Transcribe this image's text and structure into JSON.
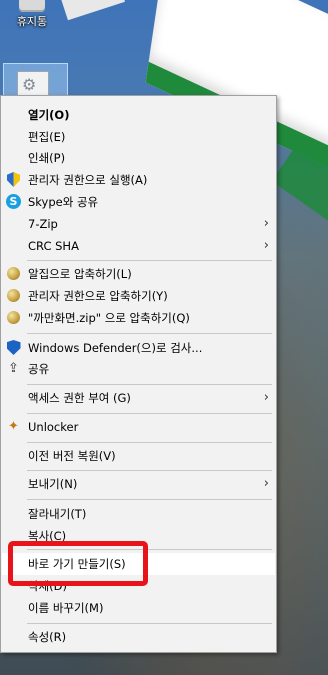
{
  "desktop": {
    "recycle_bin_label": "휴지통"
  },
  "context_menu": {
    "items": [
      {
        "label": "열기(O)",
        "icon": "",
        "bold": true
      },
      {
        "label": "편집(E)",
        "icon": ""
      },
      {
        "label": "인쇄(P)",
        "icon": ""
      },
      {
        "label": "관리자 권한으로 실행(A)",
        "icon": "uac-shield-icon"
      },
      {
        "label": "Skype와 공유",
        "icon": "skype-icon"
      },
      {
        "label": "7-Zip",
        "icon": "",
        "submenu": true
      },
      {
        "label": "CRC SHA",
        "icon": "",
        "submenu": true
      },
      {
        "label": "알집으로 압축하기(L)",
        "icon": "alzip-icon"
      },
      {
        "label": "관리자 권한으로 압축하기(Y)",
        "icon": "alzip-admin-icon"
      },
      {
        "label": "\"까만화면.zip\" 으로 압축하기(Q)",
        "icon": "alzip-icon"
      },
      {
        "label": "Windows Defender(으)로 검사...",
        "icon": "defender-icon"
      },
      {
        "label": "공유",
        "icon": "share-icon"
      },
      {
        "label": "액세스 권한 부여 (G)",
        "icon": "",
        "submenu": true
      },
      {
        "label": "Unlocker",
        "icon": "unlocker-wand-icon"
      },
      {
        "label": "이전 버전 복원(V)",
        "icon": ""
      },
      {
        "label": "보내기(N)",
        "icon": "",
        "submenu": true
      },
      {
        "label": "잘라내기(T)",
        "icon": ""
      },
      {
        "label": "복사(C)",
        "icon": ""
      },
      {
        "label": "바로 가기 만들기(S)",
        "icon": "",
        "highlighted": true
      },
      {
        "label": "삭제(D)",
        "icon": ""
      },
      {
        "label": "이름 바꾸기(M)",
        "icon": ""
      },
      {
        "label": "속성(R)",
        "icon": ""
      }
    ],
    "submenu_arrow": "›",
    "skype_glyph": "S"
  },
  "annotation": {
    "color": "#e8141a",
    "target": "바로 가기 만들기(S)"
  },
  "colors": {
    "menu_bg": "#f2f2f2",
    "highlight_bg": "#ffffff",
    "separator": "#c8c8c8"
  }
}
